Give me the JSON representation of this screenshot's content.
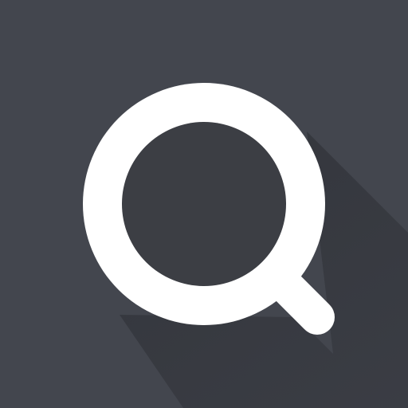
{
  "icon": {
    "name": "search-icon",
    "background_color": "#43464e",
    "glyph_color": "#ffffff",
    "lens_fill_color": "#3c3e44",
    "shadow_color": "#2e3036"
  }
}
